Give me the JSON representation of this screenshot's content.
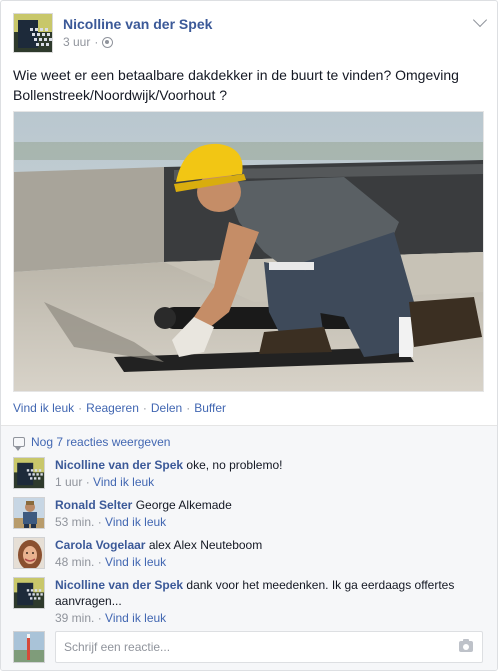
{
  "post": {
    "author": "Nicolline van der Spek",
    "time": "3 uur",
    "meta_separator": "·",
    "privacy_icon": "globe-icon",
    "text": "Wie weet er een betaalbare dakdekker in de buurt te vinden? Omgeving Bollenstreek/Noordwijk/Voorhout ?",
    "image_description_icon": "roofer-photo",
    "actions": [
      "Vind ik leuk",
      "Reageren",
      "Delen",
      "Buffer"
    ]
  },
  "comments_section": {
    "more_label": "Nog 7 reacties weergeven",
    "items": [
      {
        "author": "Nicolline van der Spek",
        "text": "oke, no problemo!",
        "time": "1 uur",
        "like": "Vind ik leuk"
      },
      {
        "author": "Ronald Selter",
        "text": "George Alkemade",
        "time": "53 min.",
        "like": "Vind ik leuk"
      },
      {
        "author": "Carola Vogelaar",
        "text": "alex Alex Neuteboom",
        "time": "48 min.",
        "like": "Vind ik leuk"
      },
      {
        "author": "Nicolline van der Spek",
        "text": "dank voor het meedenken. Ik ga eerdaags offertes aanvragen...",
        "time": "39 min.",
        "like": "Vind ik leuk"
      }
    ],
    "reply_placeholder": "Schrijf een reactie..."
  },
  "colors": {
    "link": "#3b5998",
    "action": "#4267b2",
    "meta": "#90949c",
    "background": "#f6f7f9"
  }
}
